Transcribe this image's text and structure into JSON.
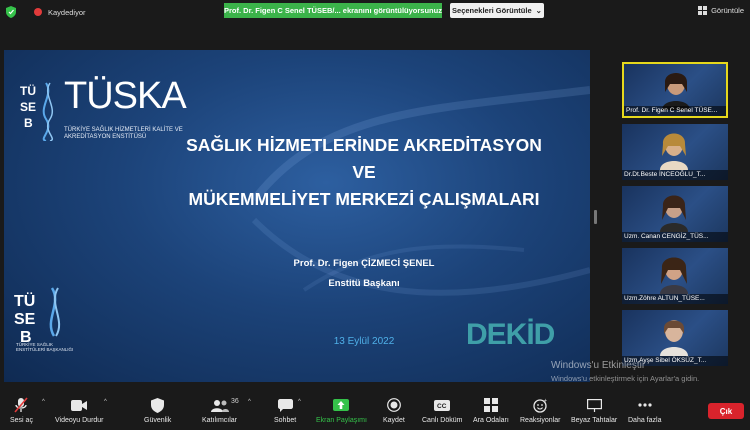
{
  "top_bar": {
    "recording_label": "Kaydediyor",
    "share_banner": "Prof. Dr. Figen C Senel TÜSEB/... ekranını görüntülüyorsunuz",
    "view_options_label": "Seçenekleri Görüntüle",
    "view_label": "Görüntüle"
  },
  "slide": {
    "logo_text": "TÜSKA",
    "logo_sub": "TÜRKİYE SAĞLIK HİZMETLERİ KALİTE VE AKREDİTASYON ENSTİTÜSÜ",
    "title_line1": "SAĞLIK HİZMETLERİNDE AKREDİTASYON",
    "title_line2": "VE",
    "title_line3": "MÜKEMMELİYET MERKEZİ ÇALIŞMALARI",
    "presenter": "Prof. Dr. Figen ÇİZMECİ ŞENEL",
    "role": "Enstitü Başkanı",
    "date": "13 Eylül 2022",
    "dekid_text": "DEKİD",
    "tuseb_bottom_text": "TÜRKİYE SAĞLIK ENSTİTÜLERİ BAŞKANLIĞI"
  },
  "participants": [
    {
      "name": "Prof. Dr. Figen C Senel TÜSE...",
      "active": true
    },
    {
      "name": "Dr.Dt.Beste İNCEOĞLU_T...",
      "active": false
    },
    {
      "name": "Uzm. Canan CENGİZ_TÜS...",
      "active": false
    },
    {
      "name": "Uzm.Zöhre ALTUN_TÜSE...",
      "active": false
    },
    {
      "name": "Uzm.Ayşe Sibel ÖKSÜZ_T...",
      "active": false
    }
  ],
  "watermark": {
    "title": "Windows'u Etkinleştir",
    "subtitle": "Windows'u etkinleştirmek için Ayarlar'a gidin."
  },
  "toolbar": {
    "audio": "Sesi aç",
    "video": "Videoyu Durdur",
    "security": "Güvenlik",
    "participants": "Katılımcılar",
    "participants_count": "36",
    "chat": "Sohbet",
    "share": "Ekran Paylaşımı",
    "record": "Kaydet",
    "captions": "Canlı Döküm",
    "breakout": "Ara Odaları",
    "reactions": "Reaksiyonlar",
    "whiteboard": "Beyaz Tahtalar",
    "more": "Daha fazla",
    "leave": "Çık"
  },
  "colors": {
    "share_green": "#3bb34a",
    "leave_red": "#d9232c",
    "active_border": "#e6d81c",
    "date_blue": "#4fb0e8"
  }
}
